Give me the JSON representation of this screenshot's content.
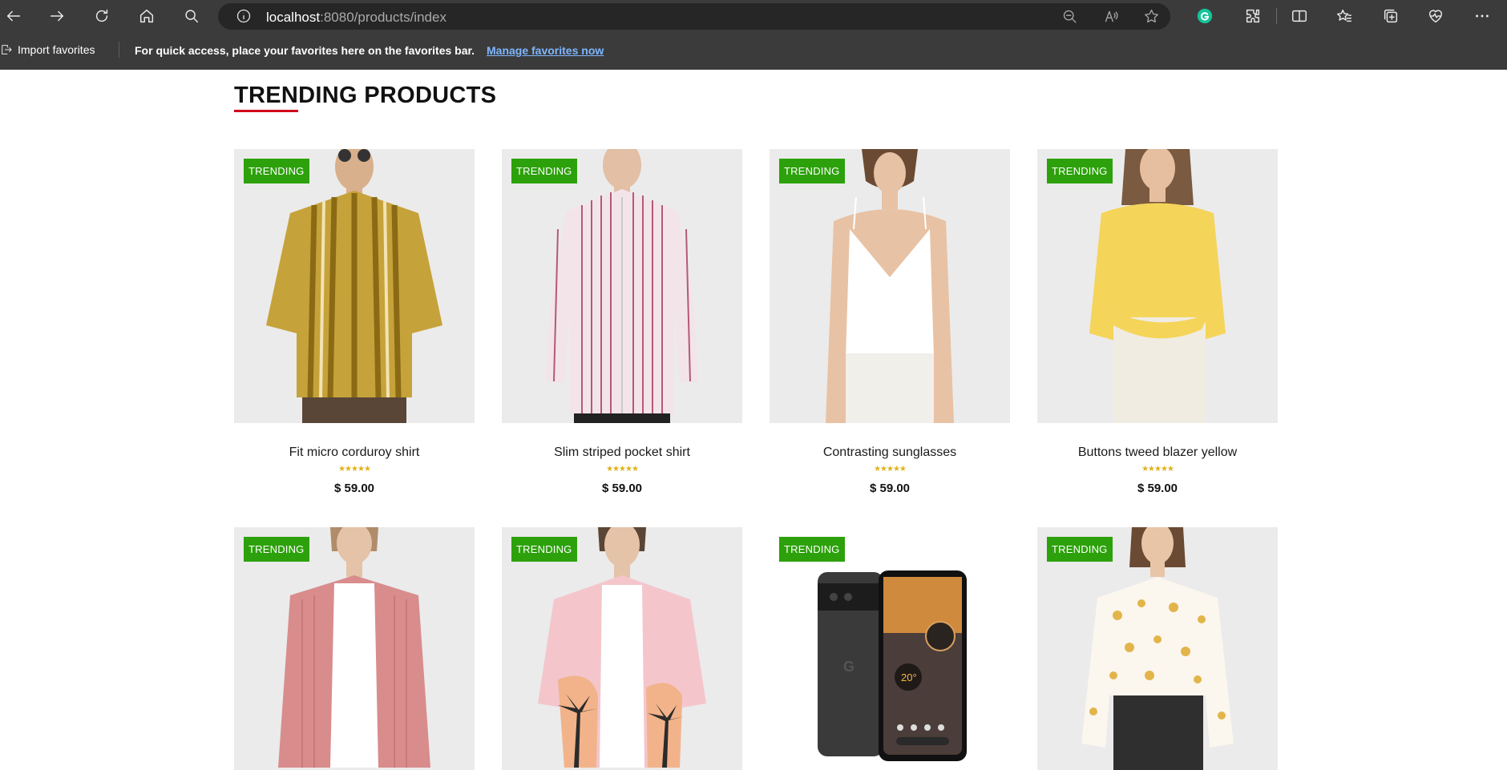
{
  "browser": {
    "url_host": "localhost",
    "url_rest": ":8080/products/index",
    "favorites_bar": {
      "import_label": "Import favorites",
      "message": "For quick access, place your favorites here on the favorites bar.",
      "manage_link": "Manage favorites now"
    }
  },
  "section": {
    "title": "TRENDING PRODUCTS"
  },
  "products": [
    {
      "badge": "TRENDING",
      "name": "Fit micro corduroy shirt",
      "rating": "★★★★★",
      "price": "$ 59.00",
      "image": "striped-mustard-shirt"
    },
    {
      "badge": "TRENDING",
      "name": "Slim striped pocket shirt",
      "rating": "★★★★★",
      "price": "$ 59.00",
      "image": "pink-striped-shirt"
    },
    {
      "badge": "TRENDING",
      "name": "Contrasting sunglasses",
      "rating": "★★★★★",
      "price": "$ 59.00",
      "image": "white-camisole"
    },
    {
      "badge": "TRENDING",
      "name": "Buttons tweed blazer yellow",
      "rating": "★★★★★",
      "price": "$ 59.00",
      "image": "yellow-blouse"
    },
    {
      "badge": "TRENDING",
      "image": "pink-overshirt"
    },
    {
      "badge": "TRENDING",
      "image": "palm-print-shirt"
    },
    {
      "badge": "TRENDING",
      "image": "pixel-phone"
    },
    {
      "badge": "TRENDING",
      "image": "floral-blouse"
    }
  ],
  "colors": {
    "chrome_bg": "#3b3b3b",
    "address_bg": "#262626",
    "badge": "#2ca10b",
    "title_underline": "#d0021b",
    "stars": "#e0b21b"
  }
}
